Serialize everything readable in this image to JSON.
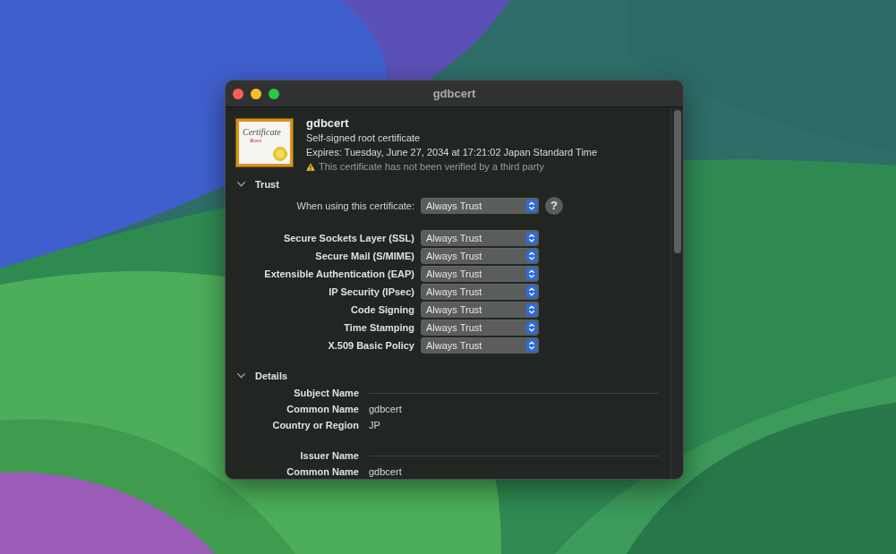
{
  "window": {
    "title": "gdbcert"
  },
  "certificate": {
    "icon_text": [
      "Certificate",
      "Root"
    ],
    "name": "gdbcert",
    "description": "Self-signed root certificate",
    "expires": "Expires: Tuesday, June 27, 2034 at 17:21:02 Japan Standard Time",
    "warning": "This certificate has not been verified by a third party"
  },
  "trust": {
    "title": "Trust",
    "expanded": true,
    "main": {
      "label": "When using this certificate:",
      "value": "Always Trust"
    },
    "help": "?",
    "policies": [
      {
        "label": "Secure Sockets Layer (SSL)",
        "value": "Always Trust"
      },
      {
        "label": "Secure Mail (S/MIME)",
        "value": "Always Trust"
      },
      {
        "label": "Extensible Authentication (EAP)",
        "value": "Always Trust"
      },
      {
        "label": "IP Security (IPsec)",
        "value": "Always Trust"
      },
      {
        "label": "Code Signing",
        "value": "Always Trust"
      },
      {
        "label": "Time Stamping",
        "value": "Always Trust"
      },
      {
        "label": "X.509 Basic Policy",
        "value": "Always Trust"
      }
    ]
  },
  "details": {
    "title": "Details",
    "expanded": true,
    "groups": [
      {
        "title": "Subject Name",
        "fields": [
          {
            "label": "Common Name",
            "value": "gdbcert"
          },
          {
            "label": "Country or Region",
            "value": "JP"
          }
        ]
      },
      {
        "title": "Issuer Name",
        "fields": [
          {
            "label": "Common Name",
            "value": "gdbcert"
          }
        ]
      }
    ]
  }
}
